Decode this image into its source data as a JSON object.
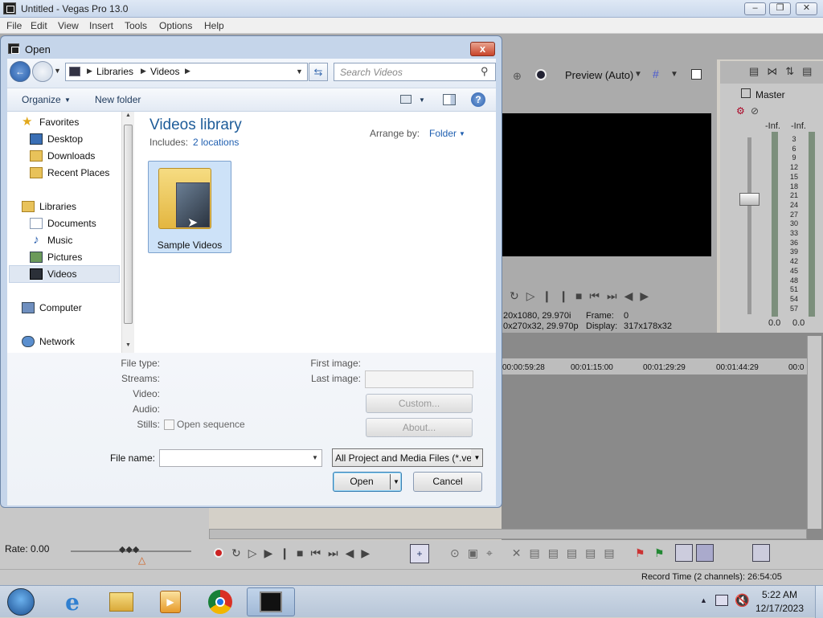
{
  "vegas": {
    "title": "Untitled - Vegas Pro 13.0",
    "menu": [
      "File",
      "Edit",
      "View",
      "Insert",
      "Tools",
      "Options",
      "Help"
    ],
    "preview_label": "Preview (Auto)",
    "preview_info_line1": "20x1080, 29.970i",
    "preview_info_line2": "0x270x32, 29.970p",
    "frame_label": "Frame:",
    "frame_value": "0",
    "display_label": "Display:",
    "display_value": "317x178x32",
    "master_label": "Master",
    "meter_left": "-Inf.",
    "meter_right": "-Inf.",
    "meter_scale": [
      "3",
      "6",
      "9",
      "12",
      "15",
      "18",
      "21",
      "24",
      "27",
      "30",
      "33",
      "36",
      "39",
      "42",
      "45",
      "48",
      "51",
      "54",
      "57"
    ],
    "meter_bottom_left": "0.0",
    "meter_bottom_right": "0.0",
    "ruler_ticks": [
      "00:00:59:28",
      "00:01:15:00",
      "00:01:29:29",
      "00:01:44:29",
      "00:0"
    ],
    "rate_label": "Rate: 0.00",
    "record_time": "Record Time (2 channels): 26:54:05"
  },
  "dialog": {
    "title": "Open",
    "close_glyph": "x",
    "breadcrumb": [
      "Libraries",
      "Videos"
    ],
    "search_placeholder": "Search Videos",
    "organize_label": "Organize",
    "new_folder_label": "New folder",
    "library_title": "Videos library",
    "includes_label": "Includes:",
    "includes_link": "2 locations",
    "arrange_label": "Arrange by:",
    "arrange_value": "Folder",
    "nav": {
      "favorites": "Favorites",
      "desktop": "Desktop",
      "downloads": "Downloads",
      "recent": "Recent Places",
      "libraries": "Libraries",
      "documents": "Documents",
      "music": "Music",
      "pictures": "Pictures",
      "videos": "Videos",
      "computer": "Computer",
      "network": "Network"
    },
    "folder_item": "Sample Videos",
    "details": {
      "file_type": "File type:",
      "streams": "Streams:",
      "video": "Video:",
      "audio": "Audio:",
      "stills": "Stills:",
      "open_sequence": "Open sequence",
      "first_image": "First image:",
      "last_image": "Last image:",
      "custom_button": "Custom...",
      "about_button": "About..."
    },
    "file_name_label": "File name:",
    "file_name_value": "",
    "filter_value": "All Project and Media Files (*.ve",
    "open_button": "Open",
    "cancel_button": "Cancel"
  },
  "taskbar": {
    "clock_time": "5:22 AM",
    "clock_date": "12/17/2023"
  }
}
